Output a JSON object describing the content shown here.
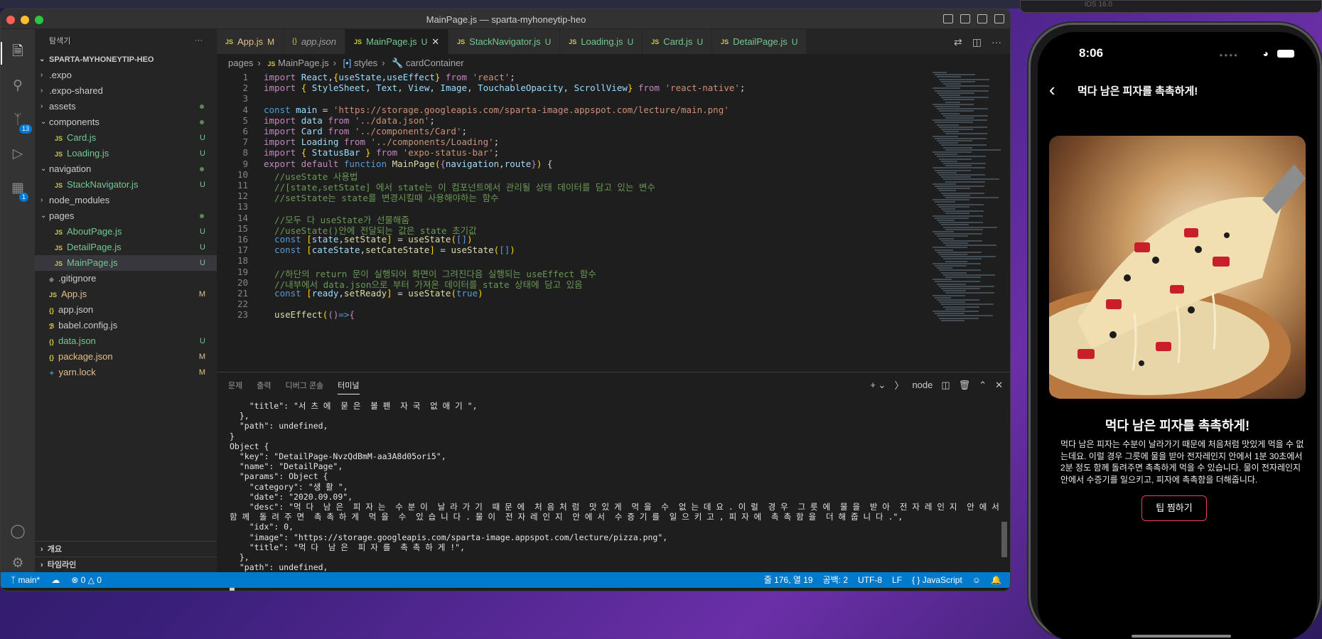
{
  "window": {
    "title": "MainPage.js — sparta-myhoneytip-heo"
  },
  "simulator_top": {
    "label": "iOS 16.0"
  },
  "activity": {
    "source_control_badge": "13",
    "extensions_badge": "1"
  },
  "explorer": {
    "title": "탐색기",
    "project": "SPARTA-MYHONEYTIP-HEO",
    "items": [
      {
        "label": ".expo",
        "kind": "folder",
        "depth": 1,
        "status": ""
      },
      {
        "label": ".expo-shared",
        "kind": "folder",
        "depth": 1,
        "status": ""
      },
      {
        "label": "assets",
        "kind": "folder",
        "depth": 1,
        "status": "dot"
      },
      {
        "label": "components",
        "kind": "folder-open",
        "depth": 1,
        "status": "dot"
      },
      {
        "label": "Card.js",
        "kind": "js",
        "depth": 2,
        "status": "U"
      },
      {
        "label": "Loading.js",
        "kind": "js",
        "depth": 2,
        "status": "U"
      },
      {
        "label": "navigation",
        "kind": "folder-open",
        "depth": 1,
        "status": "dot"
      },
      {
        "label": "StackNavigator.js",
        "kind": "js",
        "depth": 2,
        "status": "U"
      },
      {
        "label": "node_modules",
        "kind": "folder",
        "depth": 1,
        "status": ""
      },
      {
        "label": "pages",
        "kind": "folder-open",
        "depth": 1,
        "status": "dot"
      },
      {
        "label": "AboutPage.js",
        "kind": "js",
        "depth": 2,
        "status": "U"
      },
      {
        "label": "DetailPage.js",
        "kind": "js",
        "depth": 2,
        "status": "U"
      },
      {
        "label": "MainPage.js",
        "kind": "js",
        "depth": 2,
        "status": "U"
      },
      {
        "label": ".gitignore",
        "kind": "file",
        "depth": 1,
        "status": ""
      },
      {
        "label": "App.js",
        "kind": "js",
        "depth": 1,
        "status": "M"
      },
      {
        "label": "app.json",
        "kind": "json",
        "depth": 1,
        "status": ""
      },
      {
        "label": "babel.config.js",
        "kind": "babel",
        "depth": 1,
        "status": ""
      },
      {
        "label": "data.json",
        "kind": "json",
        "depth": 1,
        "status": "U"
      },
      {
        "label": "package.json",
        "kind": "json",
        "depth": 1,
        "status": "M"
      },
      {
        "label": "yarn.lock",
        "kind": "yarn",
        "depth": 1,
        "status": "M"
      }
    ],
    "outline": "개요",
    "timeline": "타임라인"
  },
  "tabs": [
    {
      "label": "App.js",
      "icon": "JS",
      "flag": "M",
      "style": "m"
    },
    {
      "label": "app.json",
      "icon": "{}",
      "flag": "",
      "style": "it"
    },
    {
      "label": "MainPage.js",
      "icon": "JS",
      "flag": "U",
      "style": "u",
      "active": true
    },
    {
      "label": "StackNavigator.js",
      "icon": "JS",
      "flag": "U",
      "style": "u"
    },
    {
      "label": "Loading.js",
      "icon": "JS",
      "flag": "U",
      "style": "u"
    },
    {
      "label": "Card.js",
      "icon": "JS",
      "flag": "U",
      "style": "u"
    },
    {
      "label": "DetailPage.js",
      "icon": "JS",
      "flag": "U",
      "style": "u"
    }
  ],
  "breadcrumb": {
    "folder": "pages",
    "file": "MainPage.js",
    "symbol1": "styles",
    "symbol2": "cardContainer"
  },
  "code": {
    "line_numbers": [
      "1",
      "2",
      "3",
      "4",
      "5",
      "6",
      "7",
      "8",
      "9",
      "10",
      "11",
      "12",
      "13",
      "14",
      "15",
      "16",
      "17",
      "18",
      "19",
      "20",
      "21",
      "22",
      "23"
    ],
    "lines": [
      [
        [
          "k",
          "import "
        ],
        [
          "v",
          "React"
        ],
        [
          "p",
          ","
        ],
        [
          "b",
          "{"
        ],
        [
          "v",
          "useState"
        ],
        [
          "p",
          ","
        ],
        [
          "v",
          "useEffect"
        ],
        [
          "b",
          "}"
        ],
        [
          "k",
          " from "
        ],
        [
          "s",
          "'react'"
        ],
        [
          "p",
          ";"
        ]
      ],
      [
        [
          "k",
          "import "
        ],
        [
          "b",
          "{ "
        ],
        [
          "v",
          "StyleSheet"
        ],
        [
          "p",
          ", "
        ],
        [
          "v",
          "Text"
        ],
        [
          "p",
          ", "
        ],
        [
          "v",
          "View"
        ],
        [
          "p",
          ", "
        ],
        [
          "v",
          "Image"
        ],
        [
          "p",
          ", "
        ],
        [
          "v",
          "TouchableOpacity"
        ],
        [
          "p",
          ", "
        ],
        [
          "v",
          "ScrollView"
        ],
        [
          "b",
          "}"
        ],
        [
          "k",
          " from "
        ],
        [
          "s",
          "'react-native'"
        ],
        [
          "p",
          ";"
        ]
      ],
      [],
      [
        [
          "kb",
          "const "
        ],
        [
          "v",
          "main"
        ],
        [
          "p",
          " = "
        ],
        [
          "s",
          "'https://storage.googleapis.com/sparta-image.appspot.com/lecture/main.png'"
        ]
      ],
      [
        [
          "k",
          "import "
        ],
        [
          "v",
          "data"
        ],
        [
          "k",
          " from "
        ],
        [
          "s",
          "'../data.json'"
        ],
        [
          "p",
          ";"
        ]
      ],
      [
        [
          "k",
          "import "
        ],
        [
          "v",
          "Card"
        ],
        [
          "k",
          " from "
        ],
        [
          "s",
          "'../components/Card'"
        ],
        [
          "p",
          ";"
        ]
      ],
      [
        [
          "k",
          "import "
        ],
        [
          "v",
          "Loading"
        ],
        [
          "k",
          " from "
        ],
        [
          "s",
          "'../components/Loading'"
        ],
        [
          "p",
          ";"
        ]
      ],
      [
        [
          "k",
          "import "
        ],
        [
          "b",
          "{ "
        ],
        [
          "v",
          "StatusBar"
        ],
        [
          "b",
          " }"
        ],
        [
          "k",
          " from "
        ],
        [
          "s",
          "'expo-status-bar'"
        ],
        [
          "p",
          ";"
        ]
      ],
      [
        [
          "k",
          "export default "
        ],
        [
          "kb",
          "function "
        ],
        [
          "f",
          "MainPage"
        ],
        [
          "b",
          "("
        ],
        [
          "k",
          "{"
        ],
        [
          "v",
          "navigation"
        ],
        [
          "p",
          ","
        ],
        [
          "v",
          "route"
        ],
        [
          "k",
          "}"
        ],
        [
          "b",
          ")"
        ],
        [
          "p",
          " {"
        ]
      ],
      [
        [
          "c",
          "  //useState 사용법"
        ]
      ],
      [
        [
          "c",
          "  //[state,setState] 에서 state는 이 컴포넌트에서 관리될 상태 데이터를 담고 있는 변수"
        ]
      ],
      [
        [
          "c",
          "  //setState는 state를 변경시킬때 사용해야하는 함수"
        ]
      ],
      [],
      [
        [
          "c",
          "  //모두 다 useState가 선물해줌"
        ]
      ],
      [
        [
          "c",
          "  //useState()안에 전달되는 값은 state 초기값"
        ]
      ],
      [
        [
          "kb",
          "  const "
        ],
        [
          "b",
          "["
        ],
        [
          "v",
          "state"
        ],
        [
          "p",
          ","
        ],
        [
          "f",
          "setState"
        ],
        [
          "b",
          "]"
        ],
        [
          "p",
          " = "
        ],
        [
          "f",
          "useState"
        ],
        [
          "b",
          "("
        ],
        [
          "kb",
          "[]"
        ],
        [
          "b",
          ")"
        ]
      ],
      [
        [
          "kb",
          "  const "
        ],
        [
          "b",
          "["
        ],
        [
          "v",
          "cateState"
        ],
        [
          "p",
          ","
        ],
        [
          "f",
          "setCateState"
        ],
        [
          "b",
          "]"
        ],
        [
          "p",
          " = "
        ],
        [
          "f",
          "useState"
        ],
        [
          "b",
          "("
        ],
        [
          "kb",
          "[]"
        ],
        [
          "b",
          ")"
        ]
      ],
      [],
      [
        [
          "c",
          "  //하단의 return 문이 실행되어 화면이 그려진다음 실행되는 useEffect 함수"
        ]
      ],
      [
        [
          "c",
          "  //내부에서 data.json으로 부터 가져온 데이터를 state 상태에 담고 있음"
        ]
      ],
      [
        [
          "kb",
          "  const "
        ],
        [
          "b",
          "["
        ],
        [
          "v",
          "ready"
        ],
        [
          "p",
          ","
        ],
        [
          "f",
          "setReady"
        ],
        [
          "b",
          "]"
        ],
        [
          "p",
          " = "
        ],
        [
          "f",
          "useState"
        ],
        [
          "b",
          "("
        ],
        [
          "kb",
          "true"
        ],
        [
          "b",
          ")"
        ]
      ],
      [],
      [
        [
          "f",
          "  useEffect"
        ],
        [
          "b",
          "("
        ],
        [
          "k",
          "()"
        ],
        [
          "kb",
          "=>"
        ],
        [
          "k",
          "{"
        ]
      ]
    ]
  },
  "panel": {
    "tabs": [
      "문제",
      "출력",
      "디버그 콘솔",
      "터미널"
    ],
    "active_tab": "터미널",
    "shell": "node",
    "terminal": "    \"title\": \"서 츠 에  묻 은  볼 펜  자 국  없 애 기 \",\n  },\n  \"path\": undefined,\n}\nObject {\n  \"key\": \"DetailPage-NvzQdBmM-aa3A8d05ori5\",\n  \"name\": \"DetailPage\",\n  \"params\": Object {\n    \"category\": \"생 활 \",\n    \"date\": \"2020.09.09\",\n    \"desc\": \"먹 다  남 은  피 자 는  수 분 이  날 라 가 기  때 문 에  처 음 처 럼  맛 있 게  먹 을  수  없 는 데 요 . 이 럴  경 우  그 릇 에  물 을  받 아  전 자 레 인 지  안 에 서  1분  30초 에 서  2분  정 도\n함 께  돌 려 주 면  촉 촉 하 게  먹 을  수  있 습 니 다 . 물 이  전 자 레 인 지  안 에 서  수 증 기 를  일 으 키 고 , 피 자 에  촉 촉 함 을  더 해 줍 니 다 .\",\n    \"idx\": 0,\n    \"image\": \"https://storage.googleapis.com/sparta-image.appspot.com/lecture/pizza.png\",\n    \"title\": \"먹 다  남 은  피 자 를  촉 촉 하 게 !\",\n  },\n  \"path\": undefined,\n}\n"
  },
  "status": {
    "branch": "main*",
    "errors": "0",
    "warnings": "0",
    "position": "줄 176, 열 19",
    "spaces": "공백: 2",
    "encoding": "UTF-8",
    "eol": "LF",
    "language": "JavaScript"
  },
  "phone": {
    "time": "8:06",
    "header_title": "먹다 남은 피자를 촉촉하게!",
    "title": "먹다 남은 피자를 촉촉하게!",
    "desc": "먹다 남은 피자는 수분이 날라가기 때문에 처음처럼 맛있게 먹을 수 없는데요. 이럴 경우 그릇에 물을 받아 전자레인지 안에서 1분 30초에서 2분 정도 함께 돌려주면 촉촉하게 먹을 수 있습니다. 물이 전자레인지 안에서 수증기를 일으키고, 피자에 촉촉함을 더해줍니다.",
    "button": "팁 찜하기"
  },
  "colors": {
    "accent": "#007acc",
    "button_border": "#e83e5a",
    "untracked": "#73c991",
    "modified": "#e2c08d"
  }
}
